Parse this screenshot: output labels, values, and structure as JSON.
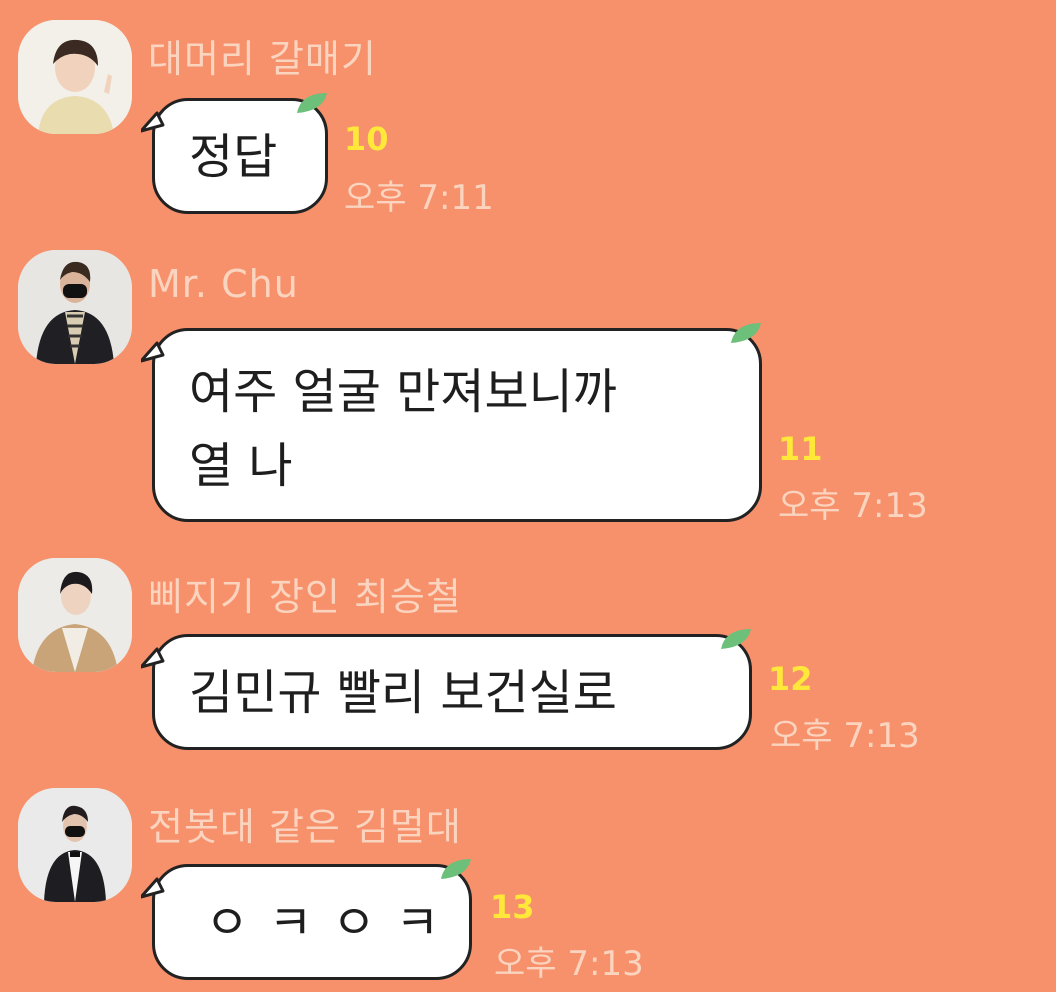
{
  "messages": [
    {
      "sender": "대머리 갈매기",
      "text": "정답",
      "count": "10",
      "time": "오후 7:11"
    },
    {
      "sender": "Mr. Chu",
      "text_line1": "여주 얼굴 만져보니까",
      "text_line2": "열 나",
      "count": "11",
      "time": "오후 7:13"
    },
    {
      "sender": "삐지기 장인 최승철",
      "text": "김민규 빨리 보건실로",
      "count": "12",
      "time": "오후 7:13"
    },
    {
      "sender": "전봇대 같은 김멀대",
      "text": "ㅇ ㅋ ㅇ ㅋ",
      "count": "13",
      "time": "오후 7:13"
    }
  ],
  "colors": {
    "background": "#f6916c",
    "name_text": "#fbd4bf",
    "unread_count": "#ffe83a",
    "bubble": "#ffffff",
    "leaf": "#6cc07a"
  },
  "icons": [
    "profile-avatar",
    "speech-tail",
    "leaf-icon"
  ]
}
